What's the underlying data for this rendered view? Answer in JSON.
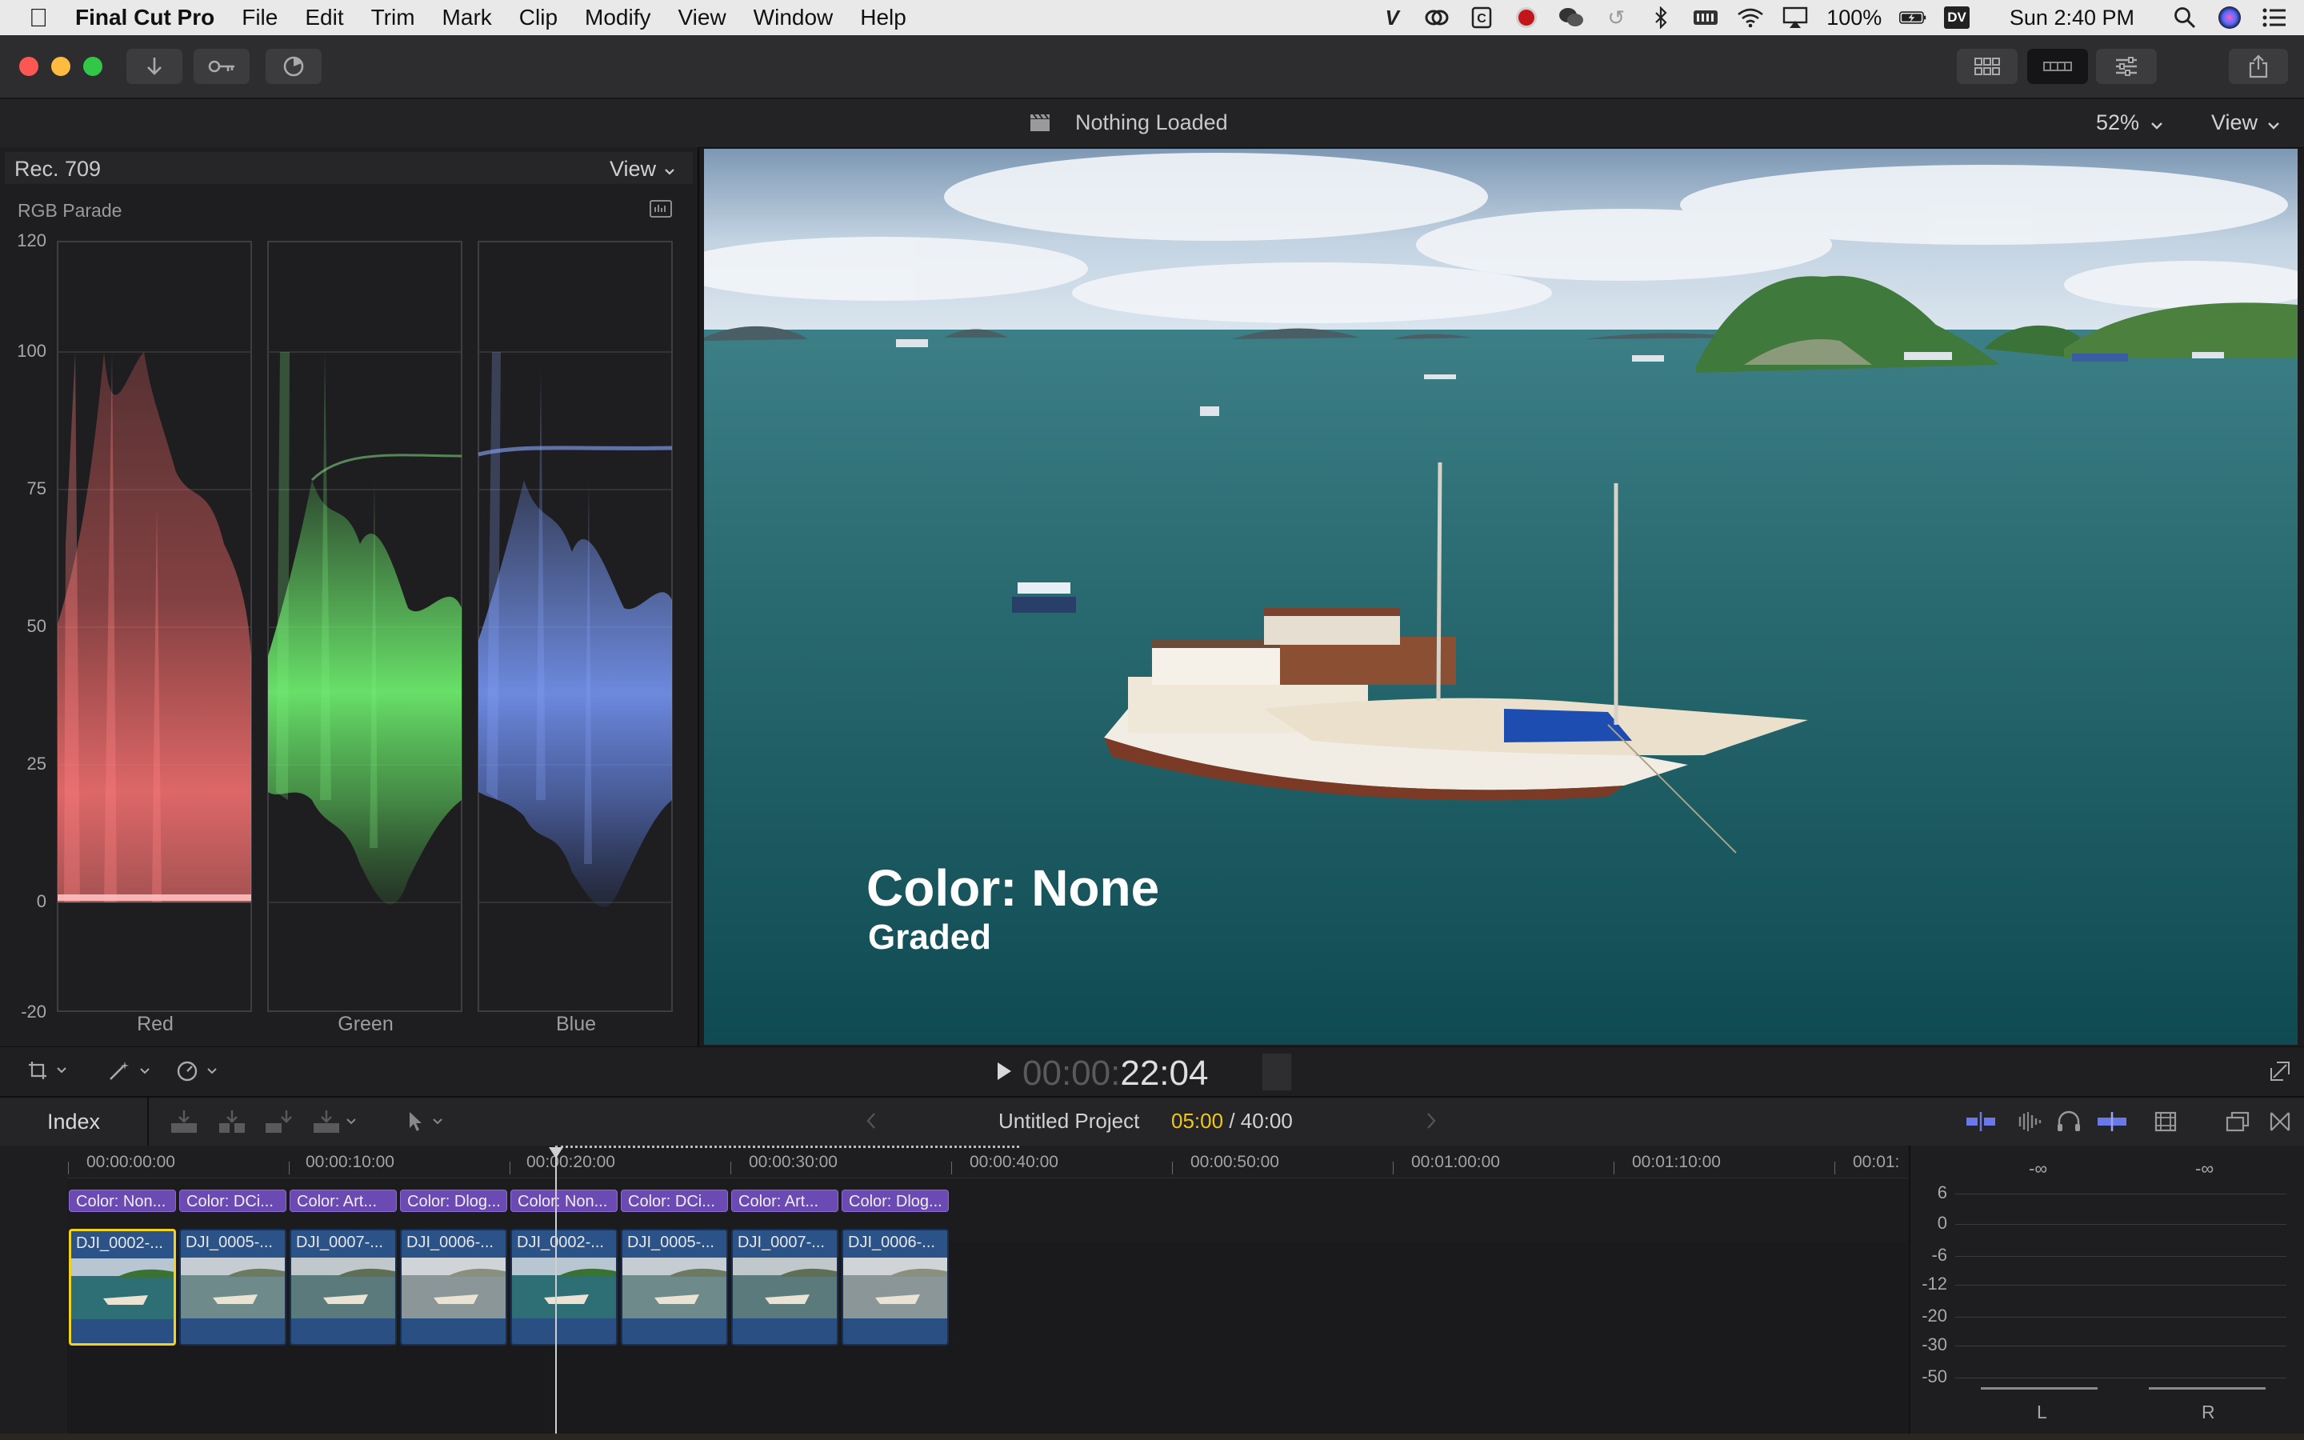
{
  "menubar": {
    "app_name": "Final Cut Pro",
    "items": [
      "File",
      "Edit",
      "Trim",
      "Mark",
      "Clip",
      "Modify",
      "View",
      "Window",
      "Help"
    ],
    "battery": "100%",
    "clock": "Sun 2:40 PM",
    "dv_badge": "DV"
  },
  "viewer_header": {
    "status": "Nothing Loaded",
    "zoom": "52%",
    "view_label": "View"
  },
  "scopes": {
    "mode": "Rec. 709",
    "view_label": "View",
    "scope_type": "RGB Parade",
    "y_ticks": [
      "120",
      "100",
      "75",
      "50",
      "25",
      "0",
      "-20"
    ],
    "channels": [
      "Red",
      "Green",
      "Blue"
    ],
    "channel_colors": [
      "#ff6b6b",
      "#6ff56f",
      "#7a9cff"
    ]
  },
  "viewer": {
    "overlay_title": "Color: None",
    "overlay_subtitle": "Graded"
  },
  "playback": {
    "timecode_dim": "00:00:",
    "timecode_bright": "22:04"
  },
  "timeline_header": {
    "index_label": "Index",
    "project_name": "Untitled Project",
    "position": "05:00",
    "duration": "/ 40:00"
  },
  "ruler": {
    "labels": [
      "00:00:00:00",
      "00:00:10:00",
      "00:00:20:00",
      "00:00:30:00",
      "00:00:40:00",
      "00:00:50:00",
      "00:01:00:00",
      "00:01:10:00",
      "00:01:"
    ]
  },
  "titles": [
    "Color: Non...",
    "Color: DCi...",
    "Color: Art...",
    "Color: Dlog...",
    "Color: Non...",
    "Color: DCi...",
    "Color: Art...",
    "Color: Dlog..."
  ],
  "clips": [
    "DJI_0002-...",
    "DJI_0005-...",
    "DJI_0007-...",
    "DJI_0006-...",
    "DJI_0002-...",
    "DJI_0005-...",
    "DJI_0007-...",
    "DJI_0006-..."
  ],
  "meters": {
    "peak_left": "-∞",
    "peak_right": "-∞",
    "ticks": [
      "6",
      "0",
      "-6",
      "-12",
      "-20",
      "-30",
      "-50"
    ],
    "channel_left": "L",
    "channel_right": "R"
  },
  "colors": {
    "accent_purple": "#6b4bb3",
    "clip_blue": "#2a4f82",
    "selection_yellow": "#f2d21b",
    "position_yellow": "#f3c614"
  }
}
